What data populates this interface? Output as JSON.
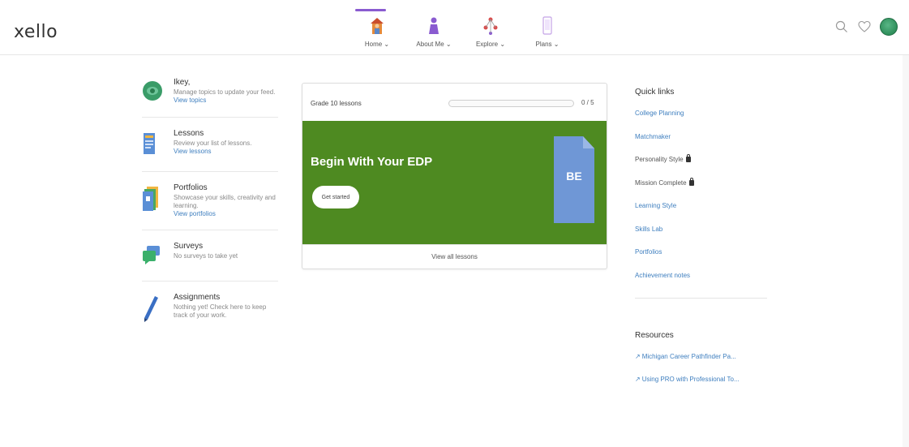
{
  "app": {
    "logo": "xello"
  },
  "nav": [
    {
      "label": "Home ⌄",
      "icon": "house-person-icon",
      "active": true
    },
    {
      "label": "About Me ⌄",
      "icon": "person-icon",
      "active": false
    },
    {
      "label": "Explore ⌄",
      "icon": "explore-network-icon",
      "active": false
    },
    {
      "label": "Plans ⌄",
      "icon": "phone-plans-icon",
      "active": false
    }
  ],
  "header_right": {
    "search": "search-icon",
    "heart": "heart-icon",
    "avatar": "user-avatar"
  },
  "left_items": [
    {
      "id": "ikey",
      "title": "Ikey,",
      "desc": "Manage topics to update your feed.",
      "link": "View topics",
      "icon": "avatar-icon"
    },
    {
      "id": "lessons",
      "title": "Lessons",
      "desc": "Review your list of lessons.",
      "link": "View lessons",
      "icon": "lessons-doc-icon"
    },
    {
      "id": "portfolios",
      "title": "Portfolios",
      "desc": "Showcase your skills, creativity and learning.",
      "link": "View portfolios",
      "icon": "portfolio-icon"
    },
    {
      "id": "surveys",
      "title": "Surveys",
      "desc": "No surveys to take yet",
      "link": "",
      "icon": "survey-chat-icon"
    },
    {
      "id": "assignments",
      "title": "Assignments",
      "desc": "Nothing yet! Check here to keep track of your work.",
      "link": "",
      "icon": "pencil-icon"
    }
  ],
  "card": {
    "lessons_label": "Grade 10 lessons",
    "progress_fraction": 0.0,
    "progress_text": "0 / 5",
    "banner_title": "Begin With Your EDP",
    "button": "Get started",
    "doc_text": "BE",
    "footer": "View all lessons"
  },
  "quick_links": {
    "heading": "Quick links",
    "items": [
      {
        "label": "College Planning",
        "locked": false
      },
      {
        "label": "Matchmaker",
        "locked": false
      },
      {
        "label": "Personality Style",
        "locked": true
      },
      {
        "label": "Mission Complete",
        "locked": true
      },
      {
        "label": "Learning Style",
        "locked": false
      },
      {
        "label": "Skills Lab",
        "locked": false
      },
      {
        "label": "Portfolios",
        "locked": false
      },
      {
        "label": "Achievement notes",
        "locked": false
      }
    ]
  },
  "resources": {
    "heading": "Resources",
    "items": [
      {
        "label": "Michigan Career Pathfinder Pa..."
      },
      {
        "label": "Using PRO with Professional To..."
      }
    ]
  },
  "colors": {
    "accent": "#8a5bd0",
    "banner": "#4e8a21",
    "link": "#3f7fbf",
    "doc": "#6f97d6"
  }
}
